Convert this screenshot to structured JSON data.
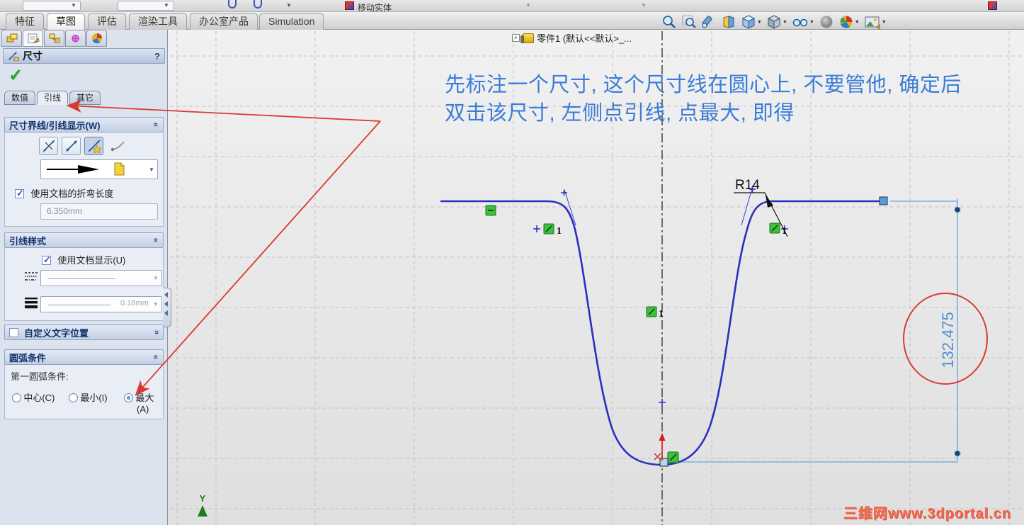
{
  "top_strip": {
    "move_entities_label": "移动实体"
  },
  "command_tabs": {
    "items": [
      {
        "label": "特征"
      },
      {
        "label": "草图"
      },
      {
        "label": "评估"
      },
      {
        "label": "渲染工具"
      },
      {
        "label": "办公室产品"
      },
      {
        "label": "Simulation"
      }
    ],
    "active": "草图"
  },
  "headsup_icons": [
    "zoom-to-fit",
    "zoom-to-area",
    "previous-view",
    "section-view",
    "view-orientation",
    "display-style",
    "hide-show-items",
    "shaded-sphere",
    "edit-appearance",
    "apply-scene"
  ],
  "feature_tree": {
    "expander": "+",
    "part_label": "零件1 (默认<<默认>_..."
  },
  "property_panel": {
    "title": "尺寸",
    "help_label": "?",
    "tabs": {
      "value": "数值",
      "leader": "引线",
      "other": "其它"
    },
    "witness_section": {
      "title": "尺寸界线/引线显示(W)",
      "use_doc_bend_label": "使用文档的折弯长度",
      "bend_length_value": "6.350mm"
    },
    "leader_style_section": {
      "title": "引线样式",
      "use_doc_display_label": "使用文档显示(U)",
      "thickness_value": "0.18mm"
    },
    "custom_text_section": {
      "title": "自定义文字位置"
    },
    "arc_section": {
      "title": "圆弧条件",
      "first_arc_label": "第一圆弧条件:",
      "center_label": "中心(C)",
      "min_label": "最小(I)",
      "max_label": "最大",
      "max_mnemonic": "(A)"
    }
  },
  "annotation": {
    "line1": "先标注一个尺寸, 这个尺寸线在圆心上, 不要管他, 确定后",
    "line2": "双击该尺寸, 左侧点引线, 点最大, 即得"
  },
  "sketch": {
    "radius_label": "R14",
    "dimension_value": "132.475",
    "constraint_label_1": "1",
    "constraint_label_2": "1",
    "constraint_label_3": "1",
    "axis_label": "Y"
  },
  "watermark": {
    "text": "三维网www.3dportal.cn"
  },
  "colors": {
    "sketch_blue": "#2a2fc0",
    "selection_blue": "#7db0e0",
    "dimension_text_blue": "#4d8fd6",
    "annotation_red": "#d93a30",
    "constraint_green": "#3fbf3f",
    "note_blue": "#3b7cd6"
  }
}
